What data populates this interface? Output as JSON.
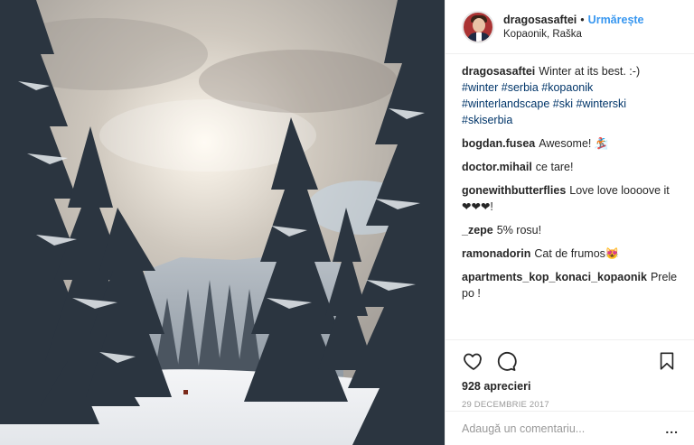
{
  "post": {
    "username": "dragosasaftei",
    "separator": "•",
    "follow_label": "Urmărește",
    "location": "Kopaonik, Raška"
  },
  "comments": [
    {
      "user": "dragosasaftei",
      "text": "Winter at its best. :-)",
      "tags": [
        "#winter",
        "#serbia",
        "#kopaonik",
        "#winterlandscape",
        "#ski",
        "#winterski",
        "#skiserbia"
      ]
    },
    {
      "user": "bogdan.fusea",
      "text": "Awesome! 🏂"
    },
    {
      "user": "doctor.mihail",
      "text": "ce tare!"
    },
    {
      "user": "gonewithbutterflies",
      "text": "Love love loooove it ❤❤❤!"
    },
    {
      "user": "_zepe",
      "text": "5% rosu!"
    },
    {
      "user": "ramonadorin",
      "text": "Cat de frumos😻"
    },
    {
      "user": "apartments_kop_konaci_kopaonik",
      "text": "Prelepo !"
    }
  ],
  "actions": {
    "like_icon": "heart-icon",
    "comment_icon": "comment-icon",
    "save_icon": "bookmark-icon"
  },
  "likes": "928 aprecieri",
  "date": "29 DECEMBRIE 2017",
  "add_comment": {
    "placeholder": "Adaugă un comentariu...",
    "more_label": "..."
  }
}
